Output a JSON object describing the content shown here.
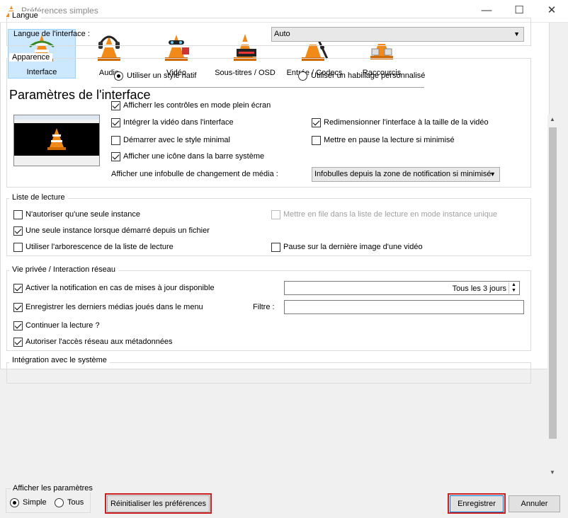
{
  "window": {
    "title": "Préférences simples",
    "minimize": "—",
    "maximize": "☐",
    "close": "✕"
  },
  "categories": [
    {
      "label": "Interface",
      "icon": "interface-cone-icon"
    },
    {
      "label": "Audio",
      "icon": "audio-cone-icon"
    },
    {
      "label": "Vidéo",
      "icon": "video-cone-icon"
    },
    {
      "label": "Sous-titres / OSD",
      "icon": "subtitles-cone-icon"
    },
    {
      "label": "Entrée / Codecs",
      "icon": "input-codecs-cone-icon"
    },
    {
      "label": "Raccourcis",
      "icon": "hotkeys-cone-icon"
    }
  ],
  "page_title": "Paramètres de l'interface",
  "langue": {
    "title": "Langue",
    "label": "Langue de l'interface :",
    "value": "Auto"
  },
  "apparence": {
    "title": "Apparence",
    "radio_native": "Utiliser un style natif",
    "radio_skin": "Utiliser un habillage personnalisé",
    "fullscreen_controls": "Afficherr les contrôles en mode plein écran",
    "embed_video": "Intégrer la vidéo dans l'interface",
    "resize_interface": "Redimensionner l'interface à la taille de la vidéo",
    "minimal_style": "Démarrer avec le style minimal",
    "pause_minimized": "Mettre en pause la lecture si minimisé",
    "systray_icon": "Afficher une icône dans la barre système",
    "media_popup_label": "Afficher une infobulle de changement de média :",
    "media_popup_value": "Infobulles depuis la zone de notification si minimisé"
  },
  "playlist": {
    "title": "Liste de lecture",
    "one_instance": "N'autoriser qu'une seule instance",
    "enqueue_one_instance": "Mettre en file dans la liste de lecture en mode instance unique",
    "one_instance_file": "Une seule instance lorsque démarré depuis un fichier",
    "tree": "Utiliser l'arborescence de la liste de lecture",
    "pause_last_frame": "Pause sur la dernière image d'une vidéo"
  },
  "privacy": {
    "title": "Vie privée / Interaction réseau",
    "update_notification": "Activer la notification en cas de mises à jour disponible",
    "update_interval": "Tous les 3 jours",
    "recent_media": "Enregistrer les derniers médias joués dans le menu",
    "filter_label": "Filtre :",
    "filter_value": "",
    "continue_playback": "Continuer la lecture ?",
    "metadata_access": "Autoriser l'accès réseau aux métadonnées"
  },
  "integration": {
    "title": "Intégration avec le système"
  },
  "show_settings": {
    "title": "Afficher les paramètres",
    "simple": "Simple",
    "all": "Tous"
  },
  "buttons": {
    "reset": "Réinitialiser les préférences",
    "save": "Enregistrer",
    "cancel": "Annuler"
  },
  "colors": {
    "highlight_border": "#cc1f1f",
    "selected_tab": "#cce8ff",
    "cone_orange": "#f28a1a"
  }
}
